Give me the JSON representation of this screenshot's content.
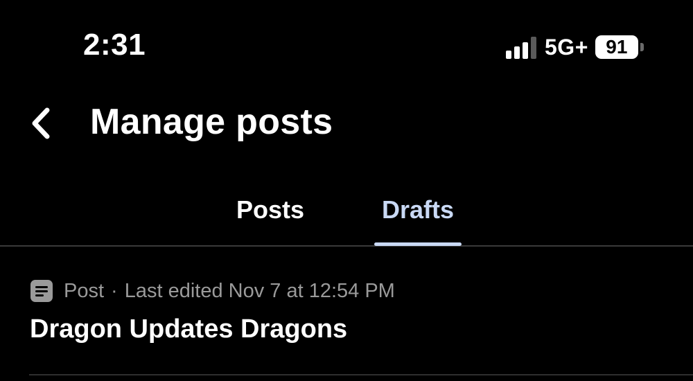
{
  "status_bar": {
    "time": "2:31",
    "network": "5G+",
    "battery": "91"
  },
  "header": {
    "back_icon": "chevron-left-icon",
    "title": "Manage posts"
  },
  "tabs": [
    {
      "label": "Posts",
      "active": false
    },
    {
      "label": "Drafts",
      "active": true
    }
  ],
  "drafts": [
    {
      "type": "Post",
      "separator": "·",
      "edited": "Last edited Nov 7 at 12:54 PM",
      "title": "Dragon Updates Dragons",
      "icon": "document-icon"
    }
  ],
  "colors": {
    "background": "#000000",
    "active_tab": "#c9d9f5",
    "muted_text": "#9a9a9a"
  }
}
